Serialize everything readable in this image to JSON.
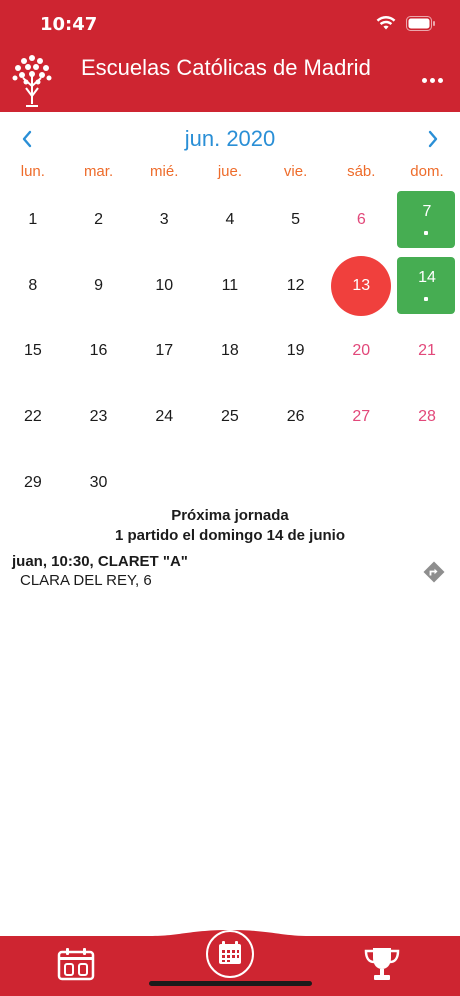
{
  "status_bar": {
    "time": "10:47"
  },
  "app_bar": {
    "title": "Escuelas Católicas de Madrid"
  },
  "calendar": {
    "month_label": "jun. 2020",
    "weekdays": [
      "lun.",
      "mar.",
      "mié.",
      "jue.",
      "vie.",
      "sáb.",
      "dom."
    ],
    "weeks": [
      [
        "1",
        "2",
        "3",
        "4",
        "5",
        "6",
        "7"
      ],
      [
        "8",
        "9",
        "10",
        "11",
        "12",
        "13",
        "14"
      ],
      [
        "15",
        "16",
        "17",
        "18",
        "19",
        "20",
        "21"
      ],
      [
        "22",
        "23",
        "24",
        "25",
        "26",
        "27",
        "28"
      ],
      [
        "29",
        "30",
        "",
        "",
        "",
        "",
        ""
      ]
    ],
    "today": "13",
    "event_days": [
      "7",
      "14"
    ]
  },
  "next_round": {
    "heading": "Próxima jornada",
    "summary": "1 partido el domingo 14 de junio"
  },
  "match": {
    "title": "juan, 10:30, CLARET \"A\"",
    "venue": "CLARA DEL REY, 6"
  },
  "colors": {
    "brand_red": "#ce2531",
    "accent_blue": "#2a8fd6",
    "weekday_orange": "#ee6c2b",
    "weekend_pink": "#e2487a",
    "today_red": "#f0403d",
    "event_green": "#46ad52"
  }
}
